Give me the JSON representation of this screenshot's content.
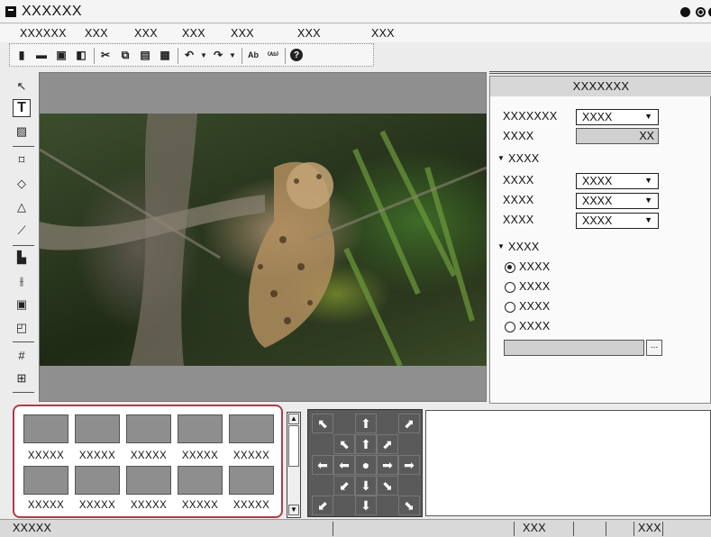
{
  "window": {
    "title": "XXXXXX"
  },
  "menu": [
    "XXXXXX",
    "XXX",
    "XXX",
    "XXX",
    "XXX",
    "XXX",
    "XXX"
  ],
  "toolbar": {
    "icons": [
      "new-icon",
      "open-icon",
      "save-icon",
      "save-as-icon",
      "cut-icon",
      "copy-icon",
      "paste-icon",
      "clipboard-icon",
      "undo-icon",
      "redo-icon",
      "text-replace-icon",
      "text-format-icon",
      "help-icon"
    ]
  },
  "left_tools": [
    "select-icon",
    "text-icon",
    "image-icon",
    "rectangle-icon",
    "ellipse-icon",
    "triangle-icon",
    "line-icon",
    "align-icon",
    "distribute-icon",
    "layer-icon",
    "arrange-icon",
    "grid-icon",
    "safe-area-icon"
  ],
  "properties": {
    "title": "XXXXXXX",
    "field1_label": "XXXXXXX",
    "field1_value": "XXXX",
    "field2_label": "XXXX",
    "field2_value": "XX",
    "section1": "XXXX",
    "rows": [
      {
        "label": "XXXX",
        "value": "XXXX"
      },
      {
        "label": "XXXX",
        "value": "XXXX"
      },
      {
        "label": "XXXX",
        "value": "XXXX"
      }
    ],
    "section2": "XXXX",
    "radios": [
      "XXXX",
      "XXXX",
      "XXXX",
      "XXXX"
    ],
    "radio_selected_index": 0,
    "browse_label": "..."
  },
  "templates": {
    "row1": [
      "XXXXX",
      "XXXXX",
      "XXXXX",
      "XXXXX",
      "XXXXX"
    ],
    "row2": [
      "XXXXX",
      "XXXXX",
      "XXXXX",
      "XXXXX",
      "XXXXX"
    ]
  },
  "status": {
    "left": "XXXXX",
    "mid": "XXX",
    "right": "XXX"
  }
}
